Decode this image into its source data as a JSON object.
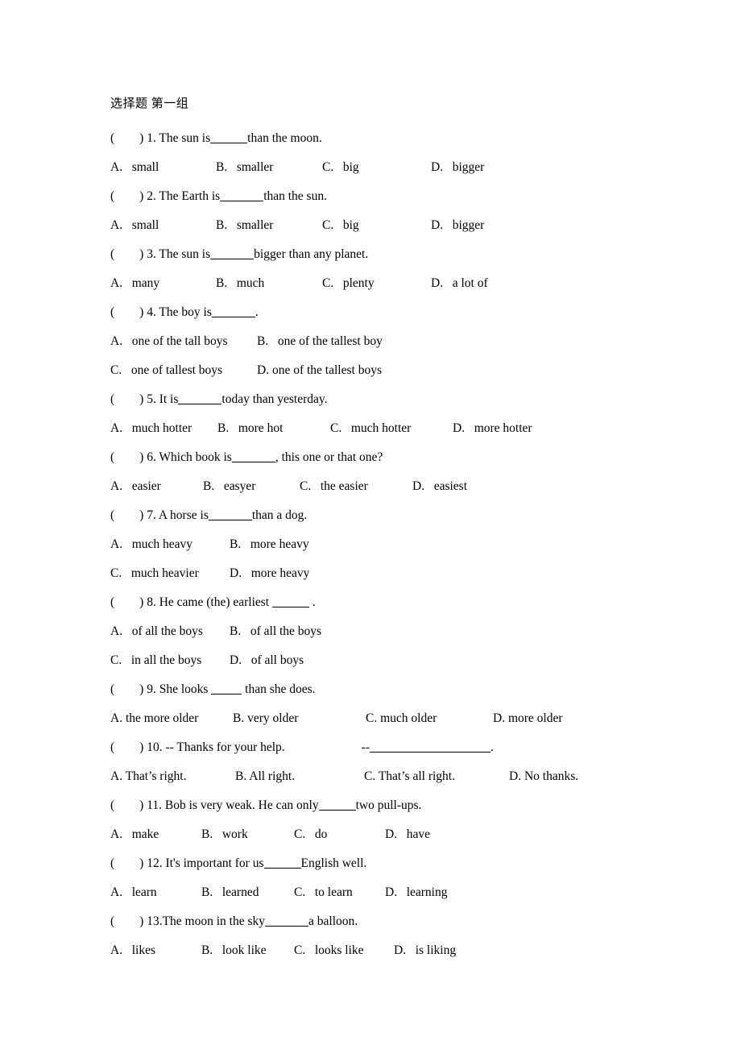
{
  "document": {
    "title": "选择题 第一组",
    "bracket_prefix": "(        ) ",
    "background_color": "#ffffff",
    "text_color": "#000000"
  },
  "questions": [
    {
      "number": "1.",
      "stem_before": " The sun is",
      "blank": "blank-s",
      "stem_after": "than the moon.",
      "option_rows": [
        [
          {
            "label": "A.",
            "text": "small"
          },
          {
            "label": "B.",
            "text": "smaller"
          },
          {
            "label": "C.",
            "text": "big"
          },
          {
            "label": "D.",
            "text": "bigger"
          }
        ]
      ],
      "option_style": "cols-4-wide"
    },
    {
      "number": "2.",
      "stem_before": " The Earth is",
      "blank": "blank-m",
      "stem_after": "than the sun.",
      "option_rows": [
        [
          {
            "label": "A.",
            "text": "small"
          },
          {
            "label": "B.",
            "text": "smaller"
          },
          {
            "label": "C.",
            "text": "big"
          },
          {
            "label": "D.",
            "text": "bigger"
          }
        ]
      ],
      "option_style": "cols-4-wide"
    },
    {
      "number": "3.",
      "stem_before": " The sun is",
      "blank": "blank-m",
      "stem_after": "bigger than any planet.",
      "option_rows": [
        [
          {
            "label": "A.",
            "text": "many"
          },
          {
            "label": "B.",
            "text": "much"
          },
          {
            "label": "C.",
            "text": "plenty"
          },
          {
            "label": "D.",
            "text": "a lot of"
          }
        ]
      ],
      "option_style": "cols-4-wide"
    },
    {
      "number": "4.",
      "stem_before": " The boy is",
      "blank": "blank-m",
      "stem_after": ".",
      "option_rows": [
        [
          {
            "label": "A.",
            "text": "one of the tall boys"
          },
          {
            "label": "B.",
            "text": "one of the tallest boy"
          }
        ],
        [
          {
            "label": "C.",
            "text": "one of tallest boys"
          },
          {
            "label": "D.",
            "text": "one of the tallest boys",
            "tight": true
          }
        ]
      ],
      "option_style": "cols-2"
    },
    {
      "number": "5.",
      "stem_before": " It is",
      "blank": "blank-m",
      "stem_after": "today than yesterday.",
      "option_rows": [
        [
          {
            "label": "A.",
            "text": "much hotter"
          },
          {
            "label": "B.",
            "text": "more hot"
          },
          {
            "label": "C.",
            "text": "much hotter"
          },
          {
            "label": "D.",
            "text": "more hotter"
          }
        ]
      ],
      "option_style": "cols-4-q5"
    },
    {
      "number": "6.",
      "stem_before": " Which book is",
      "blank": "blank-m",
      "stem_after": ", this one or that one?",
      "option_rows": [
        [
          {
            "label": "A.",
            "text": "easier"
          },
          {
            "label": "B.",
            "text": "easyer"
          },
          {
            "label": "C.",
            "text": "the easier"
          },
          {
            "label": "D.",
            "text": "easiest"
          }
        ]
      ],
      "option_style": "cols-4-q6"
    },
    {
      "number": "7.",
      "stem_before": " A horse is",
      "blank": "blank-m",
      "stem_after": "than a dog.",
      "option_rows": [
        [
          {
            "label": "A.",
            "text": "much heavy"
          },
          {
            "label": "B.",
            "text": "more heavy"
          }
        ],
        [
          {
            "label": "C.",
            "text": "much heavier"
          },
          {
            "label": "D.",
            "text": "more heavy"
          }
        ]
      ],
      "option_style": "cols-2-narrow"
    },
    {
      "number": "8.",
      "stem_before": " He came (the) earliest ",
      "blank": "blank-s",
      "stem_after": " .",
      "option_rows": [
        [
          {
            "label": "A.",
            "text": "of all the boys"
          },
          {
            "label": "B.",
            "text": "of all the boys"
          }
        ],
        [
          {
            "label": "C.",
            "text": "in all the boys"
          },
          {
            "label": "D.",
            "text": "of all boys"
          }
        ]
      ],
      "option_style": "cols-2-narrow"
    },
    {
      "number": "9.",
      "stem_before": " She looks ",
      "blank": "blank-xs",
      "stem_after": " than she does.",
      "option_rows": [
        [
          {
            "label": "A.",
            "text": "the more older",
            "tight": true
          },
          {
            "label": "B.",
            "text": "very older",
            "tight": true
          },
          {
            "label": "C.",
            "text": "much older",
            "tight": true
          },
          {
            "label": "D.",
            "text": "more older",
            "tight": true
          }
        ]
      ],
      "option_style": "cols-4-q9"
    },
    {
      "number": "10.",
      "stem_before": " -- Thanks for your help.",
      "gap": true,
      "dash": "--",
      "blank": "blank-xl",
      "stem_after": ".",
      "option_rows": [
        [
          {
            "label": "A.",
            "text": "That’s right.",
            "tight": true
          },
          {
            "label": "B.",
            "text": "All right.",
            "tight": true
          },
          {
            "label": "C.",
            "text": "That’s all right.",
            "tight": true
          },
          {
            "label": "D.",
            "text": "No thanks.",
            "tight": true
          }
        ]
      ],
      "option_style": "cols-4-q10"
    },
    {
      "number": "11.",
      "stem_before": " Bob is very weak. He can only",
      "blank": "blank-s",
      "stem_after": "two pull-ups.",
      "option_rows": [
        [
          {
            "label": "A.",
            "text": "make"
          },
          {
            "label": "B.",
            "text": "work"
          },
          {
            "label": "C.",
            "text": "do"
          },
          {
            "label": "D.",
            "text": "have"
          }
        ]
      ],
      "option_style": "cols-4-q11"
    },
    {
      "number": "12.",
      "stem_before": " It's important for us",
      "blank": "blank-s",
      "stem_after": "English well.",
      "option_rows": [
        [
          {
            "label": "A.",
            "text": "learn"
          },
          {
            "label": "B.",
            "text": "learned"
          },
          {
            "label": "C.",
            "text": "to learn"
          },
          {
            "label": "D.",
            "text": "learning"
          }
        ]
      ],
      "option_style": "cols-4-q12"
    },
    {
      "number": "13.",
      "stem_before": "The moon in the sky",
      "blank": "blank-m",
      "stem_after": "a balloon.",
      "option_rows": [
        [
          {
            "label": "A.",
            "text": "likes"
          },
          {
            "label": "B.",
            "text": "look like"
          },
          {
            "label": "C.",
            "text": "looks like"
          },
          {
            "label": "D.",
            "text": "is liking"
          }
        ]
      ],
      "option_style": "cols-4-q13"
    }
  ]
}
